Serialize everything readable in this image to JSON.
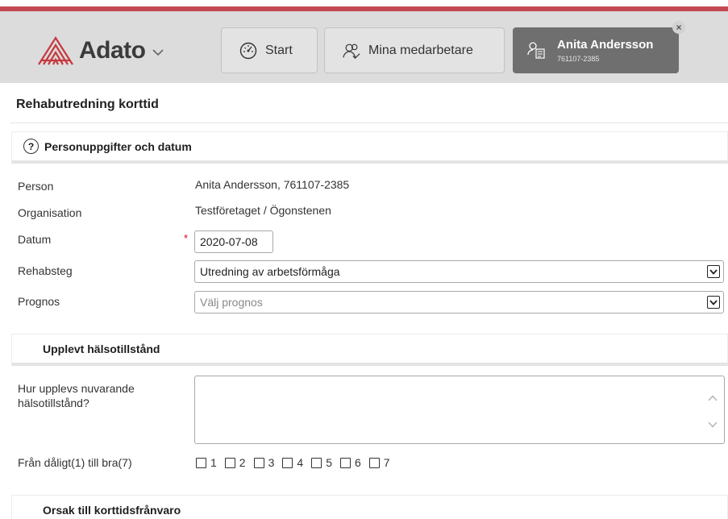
{
  "header": {
    "brand": "Adato",
    "nav": [
      {
        "label": "Start",
        "icon": "gauge-icon"
      },
      {
        "label": "Mina medarbetare",
        "icon": "people-icon"
      }
    ],
    "person_tab": {
      "name": "Anita Andersson",
      "id": "761107-2385",
      "icon": "person-file-icon"
    },
    "close_icon": "×"
  },
  "page": {
    "title": "Rehabutredning korttid"
  },
  "section1": {
    "title": "Personuppgifter och datum",
    "help_icon": "?",
    "person_label": "Person",
    "person_value": "Anita Andersson, 761107-2385",
    "org_label": "Organisation",
    "org_value": "Testföretaget / Ögonstenen",
    "date_label": "Datum",
    "required_mark": "*",
    "date_value": "2020-07-08",
    "rehab_label": "Rehabsteg",
    "rehab_value": "Utredning av arbetsförmåga",
    "prognos_label": "Prognos",
    "prognos_placeholder": "Välj prognos"
  },
  "section2": {
    "title": "Upplevt hälsotillstånd",
    "question_label": "Hur upplevs nuvarande hälsotillstånd?",
    "textarea_value": "",
    "scale_label": "Från dåligt(1) till bra(7)",
    "scale_options": [
      "1",
      "2",
      "3",
      "4",
      "5",
      "6",
      "7"
    ]
  },
  "section3": {
    "title": "Orsak till korttidsfrånvaro"
  },
  "colors": {
    "accent_line": "#c34a55",
    "header_bg": "#dcdcdc",
    "logo_red": "#c6393f",
    "person_tab_bg": "#6f6f6f"
  }
}
